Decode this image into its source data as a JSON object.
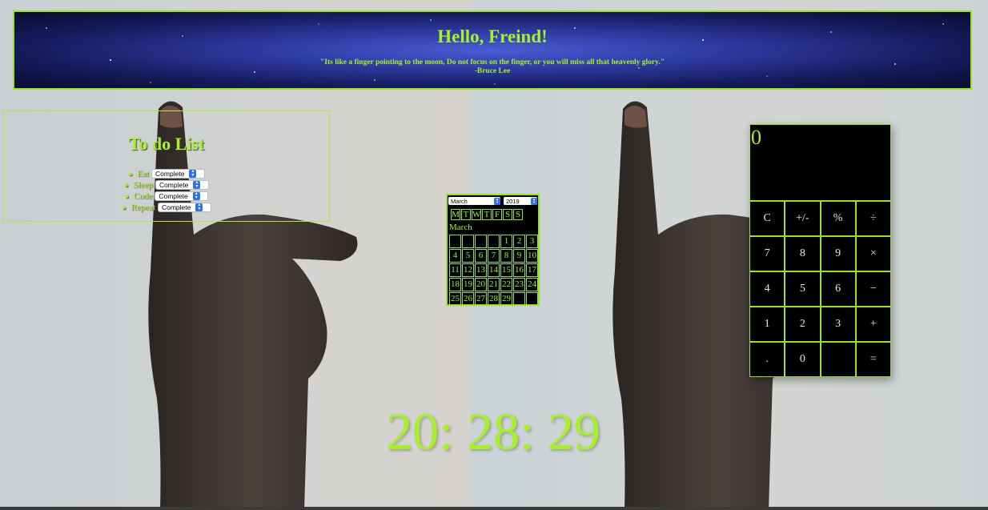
{
  "header": {
    "title": "Hello, Freind!",
    "quote": "\"Its like a finger pointing to the moon, Do not focus on the finger, or you will miss all that heavenly glory.\"",
    "author": "-Bruce Lee"
  },
  "todo": {
    "title": "To do List",
    "items": [
      {
        "label": "Eat",
        "status": "Complete"
      },
      {
        "label": "Sleep",
        "status": "Complete"
      },
      {
        "label": "Code",
        "status": "Complete"
      },
      {
        "label": "Repeat",
        "status": "Complete"
      }
    ]
  },
  "calendar": {
    "month_select": "March",
    "year_select": "2019",
    "weekdays": [
      "M",
      "T",
      "W",
      "T",
      "F",
      "S",
      "S"
    ],
    "month_label": "March",
    "rows": [
      [
        "",
        "",
        "",
        "",
        "1",
        "2",
        "3"
      ],
      [
        "4",
        "5",
        "6",
        "7",
        "8",
        "9",
        "10"
      ],
      [
        "11",
        "12",
        "13",
        "14",
        "15",
        "16",
        "17"
      ],
      [
        "18",
        "19",
        "20",
        "21",
        "22",
        "23",
        "24"
      ],
      [
        "25",
        "26",
        "27",
        "28",
        "29",
        "",
        ""
      ]
    ]
  },
  "calculator": {
    "display": "0",
    "keys": [
      "C",
      "+/-",
      "%",
      "÷",
      "7",
      "8",
      "9",
      "×",
      "4",
      "5",
      "6",
      "−",
      "1",
      "2",
      "3",
      "+",
      ".",
      "0",
      "",
      "="
    ]
  },
  "clock": {
    "time": "20: 28: 29"
  },
  "colors": {
    "accent": "#a8f02a",
    "panel": "#000000",
    "calendar_select_arrow": "#2f6fe8"
  }
}
